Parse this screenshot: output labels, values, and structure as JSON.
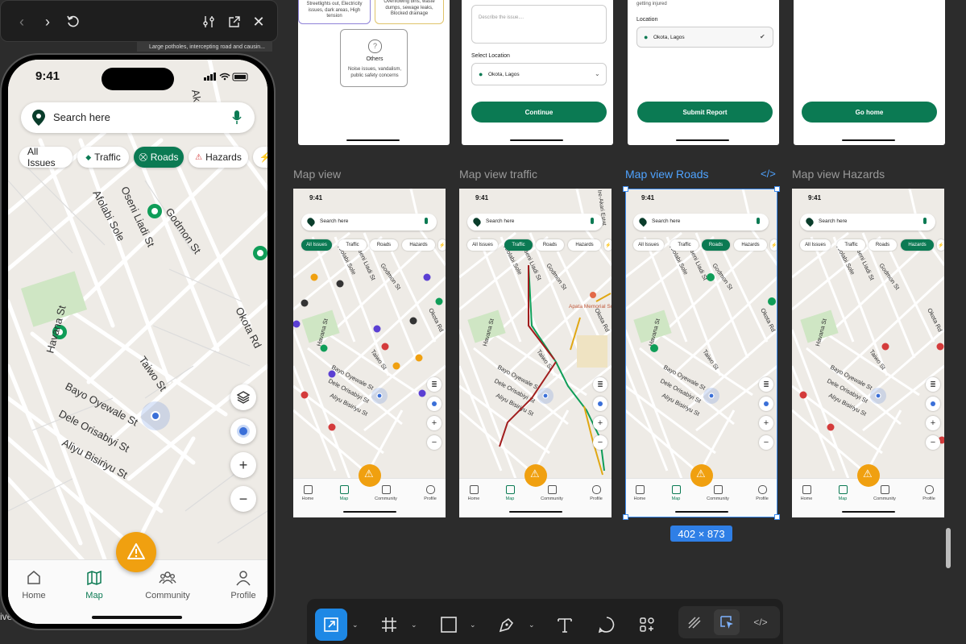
{
  "preview": {
    "thumb_text": "Large potholes, intercepting road and causin...",
    "left_text": "ive"
  },
  "phone": {
    "time": "9:41",
    "search_placeholder": "Search here",
    "chips": [
      "All Issues",
      "Traffic",
      "Roads",
      "Hazards"
    ],
    "active_chip": "Roads",
    "streets": [
      "Afolabi Sole",
      "Oseni Liadi St",
      "Godmon St",
      "Okota Rd",
      "Havana St",
      "Taiwo St",
      "Bayo Oyewale St",
      "Dele Orisabiyi St",
      "Aliyu Bisiriyu St",
      "Ak"
    ],
    "tabs": [
      "Home",
      "Map",
      "Community",
      "Profile"
    ],
    "active_tab": "Map"
  },
  "top_frames": {
    "f1": {
      "card1": "Streetlights out, Electricity issues, dark areas, High tension",
      "card2": "Overflowing bins, waste dumps, sewage leaks, Blocked drainage",
      "others_title": "Others",
      "others_desc": "Noise issues, vandalism, public safety concerns"
    },
    "f2": {
      "describe_placeholder": "Describe the issue....",
      "select_location_label": "Select Location",
      "location_value": "Okota, Lagos",
      "button": "Continue"
    },
    "f3": {
      "top_text": "getting injured",
      "location_label": "Location",
      "location_value": "Okota, Lagos",
      "button": "Submit Report"
    },
    "f4": {
      "button": "Go home"
    }
  },
  "frames": [
    {
      "label": "Map view",
      "active_chip": "All Issues"
    },
    {
      "label": "Map view traffic",
      "active_chip": "Traffic",
      "landmark": "Apata Memorial Schools",
      "street_extra": "Ire-Akari Estat"
    },
    {
      "label": "Map view Roads",
      "active_chip": "Roads"
    },
    {
      "label": "Map view Hazards",
      "active_chip": "Hazards"
    }
  ],
  "frame_common": {
    "time": "9:41",
    "search": "Search here",
    "chips": [
      "All Issues",
      "Traffic",
      "Roads",
      "Hazards"
    ],
    "tabs": [
      "Home",
      "Map",
      "Community",
      "Profile"
    ],
    "streets": [
      "Afolabi Sole",
      "Oseni Liadi St",
      "Godmon St",
      "Okota Rd",
      "Havana St",
      "Taiwo St",
      "Bayo Oyewale St",
      "Dele Orisabiyi St",
      "Aliyu Bisiriyu St"
    ]
  },
  "selection": {
    "size": "402 × 873"
  },
  "toolbar": {
    "tools": [
      "move-tool",
      "frame-tool",
      "rectangle-tool",
      "pen-tool",
      "text-tool",
      "comment-tool",
      "actions-tool"
    ],
    "modes": [
      "draw-mode",
      "design-mode",
      "dev-mode"
    ]
  },
  "colors": {
    "brand": "#0b7a53",
    "report": "#f0a010",
    "selection": "#3d8cf0",
    "canvas": "#2c2c2c"
  }
}
